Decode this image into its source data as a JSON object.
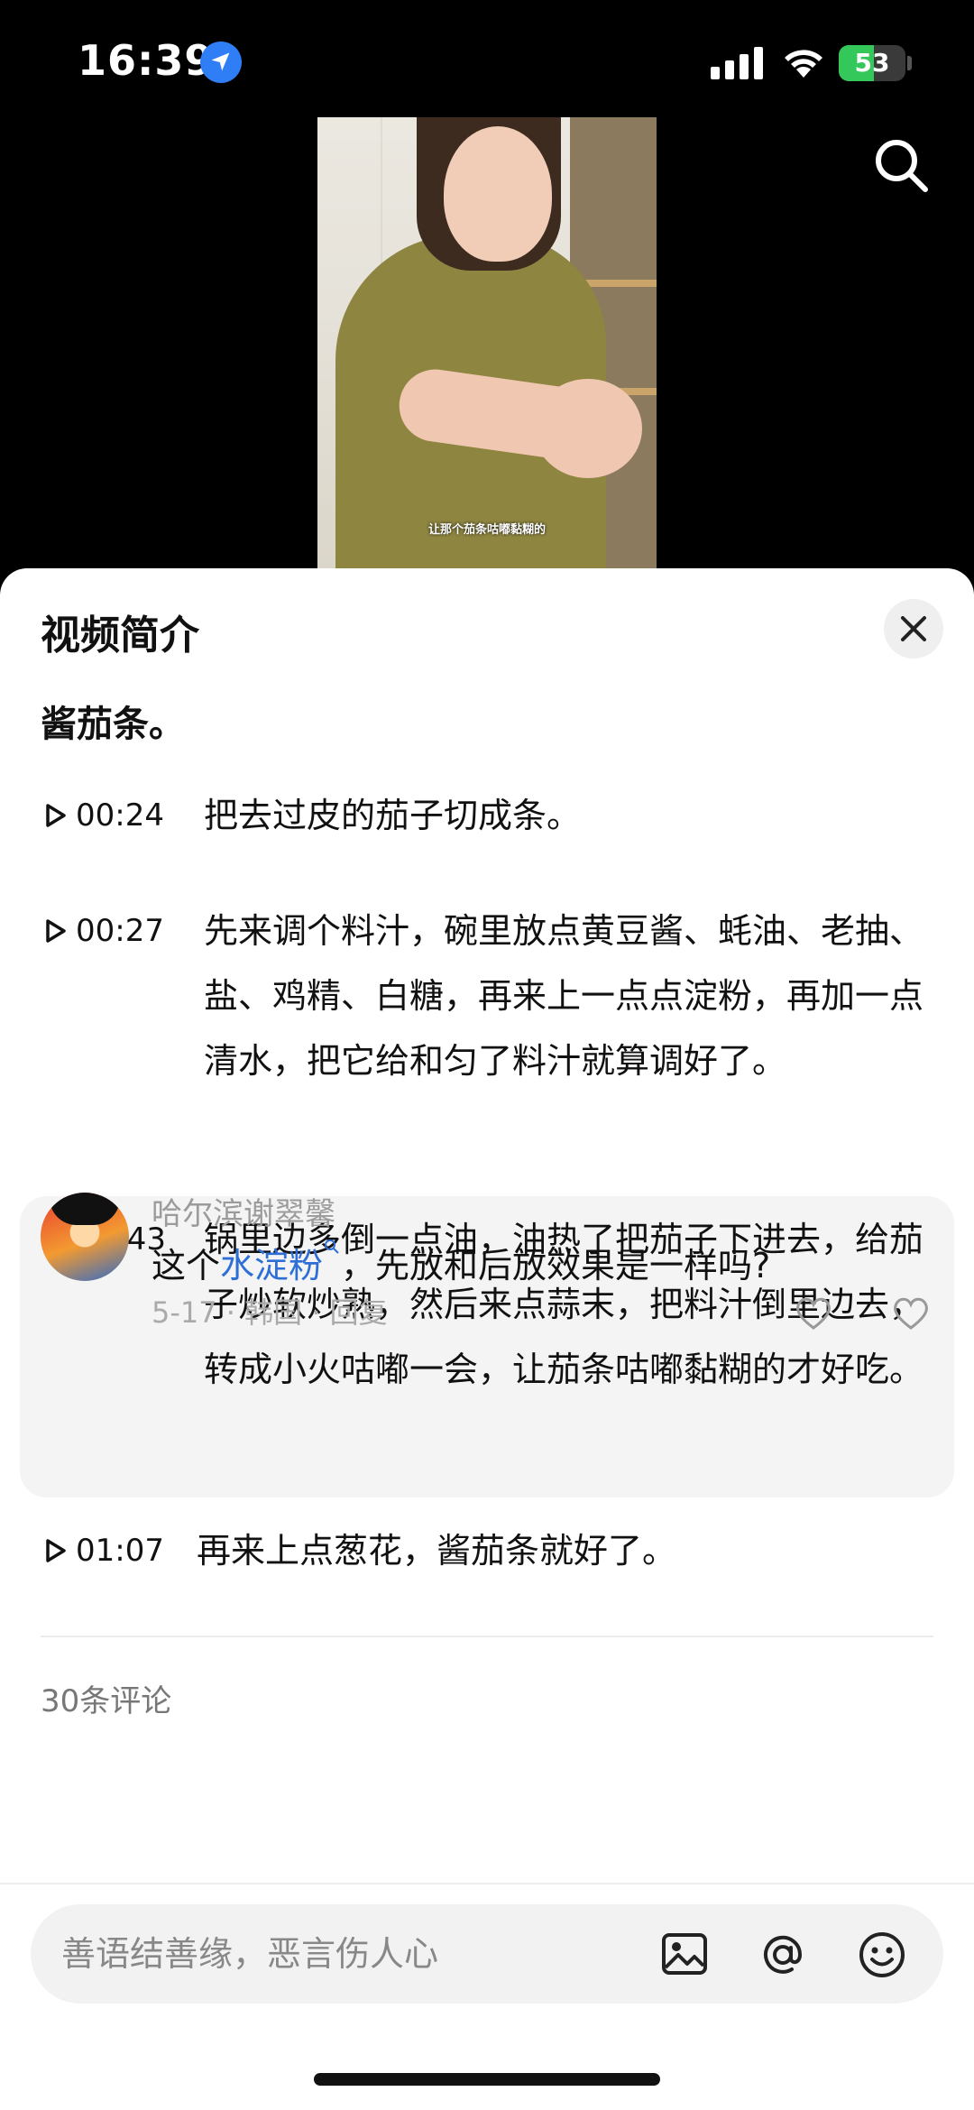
{
  "status_bar": {
    "time": "16:39",
    "battery": "53",
    "battery_level": 0.53
  },
  "video": {
    "subtitle": "让那个茄条咕嘟黏糊的"
  },
  "sheet": {
    "title": "视频简介",
    "lead": "酱茄条。",
    "chapters": [
      {
        "time": "00:24",
        "text": "把去过皮的茄子切成条。",
        "state": "play"
      },
      {
        "time": "00:27",
        "text": "先来调个料汁，碗里放点黄豆酱、蚝油、老抽、盐、鸡精、白糖，再来上一点点淀粉，再加一点清水，把它给和匀了料汁就算调好了。",
        "state": "play"
      },
      {
        "time": "00:43",
        "text": "锅里边多倒一点油，油热了把茄子下进去，给茄子炒软炒熟，然后来点蒜末，把料汁倒里边去，转成小火咕嘟一会，让茄条咕嘟黏糊的才好吃。",
        "state": "playing"
      },
      {
        "time": "01:07",
        "text": "再来上点葱花，酱茄条就好了。",
        "state": "play"
      }
    ],
    "comments_header": "30条评论",
    "comment": {
      "user": "哈尔滨谢翠馨",
      "text_before": "这个",
      "keyword": "水淀粉",
      "text_after": "，先放和后放效果是一样吗?",
      "meta": "5-17 · 韩国 · 回复"
    }
  },
  "input_bar": {
    "placeholder": "善语结善缘，恶言伤人心"
  },
  "icons": [
    "location-arrow-icon",
    "signal-icon",
    "wifi-icon",
    "battery-icon",
    "search-icon",
    "close-icon",
    "play-icon",
    "playing-bars-icon",
    "heart-icon",
    "image-icon",
    "at-icon",
    "emoji-icon"
  ],
  "colors": {
    "link": "#2e6fd6",
    "battery_fill": "#34c759",
    "location": "#2f7ef6"
  }
}
